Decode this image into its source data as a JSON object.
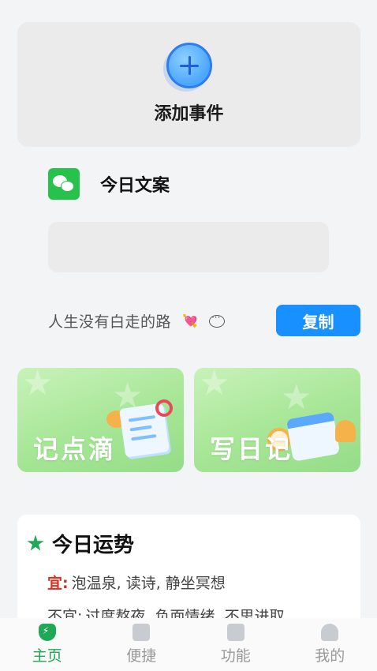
{
  "add_event": {
    "label": "添加事件",
    "icon": "plus-circle-icon"
  },
  "daily_copy": {
    "title": "今日文案",
    "quote": "人生没有白走的路",
    "heart_emoji": "💘",
    "copy_label": "复制"
  },
  "features": [
    {
      "label": "记点滴"
    },
    {
      "label": "写日记"
    }
  ],
  "fortune": {
    "title": "今日运势",
    "good_key": "宜:",
    "good_value": "泡温泉, 读诗, 静坐冥想",
    "bad_key": "不宜:",
    "bad_value": "过度熬夜, 负面情绪, 不思进取"
  },
  "tabs": [
    {
      "label": "主页",
      "icon": "shield-bolt-icon",
      "active": true
    },
    {
      "label": "便捷",
      "icon": "note-icon"
    },
    {
      "label": "功能",
      "icon": "calendar-grid-icon"
    },
    {
      "label": "我的",
      "icon": "user-icon"
    }
  ],
  "colors": {
    "accent": "#1fa855",
    "primary_button": "#1890ff",
    "good_key": "#d4301f"
  }
}
